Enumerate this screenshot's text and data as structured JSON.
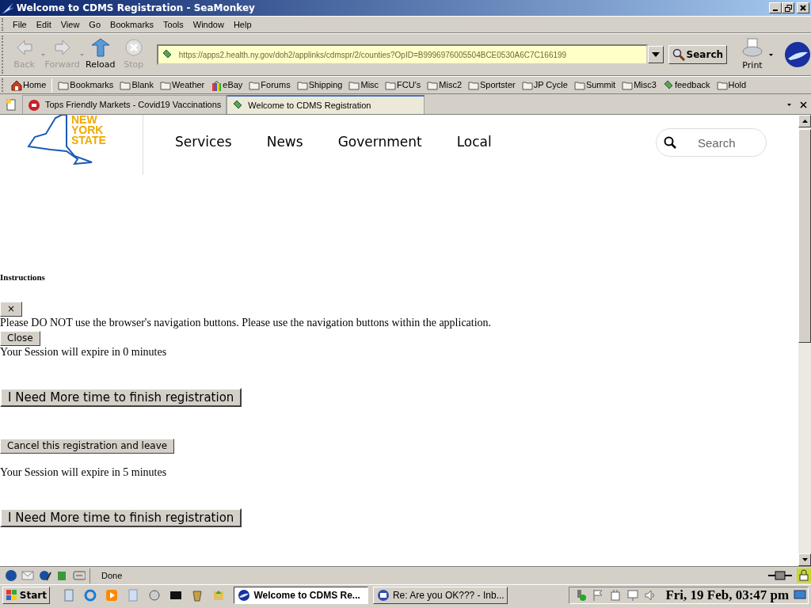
{
  "window": {
    "title": "Welcome to CDMS Registration - SeaMonkey"
  },
  "menu": [
    "File",
    "Edit",
    "View",
    "Go",
    "Bookmarks",
    "Tools",
    "Window",
    "Help"
  ],
  "nav_buttons": [
    {
      "kind": "back",
      "label": "Back",
      "disabled": true
    },
    {
      "kind": "forward",
      "label": "Forward",
      "disabled": true
    },
    {
      "kind": "reload",
      "label": "Reload",
      "disabled": false
    },
    {
      "kind": "stop",
      "label": "Stop",
      "disabled": true
    }
  ],
  "address": {
    "value": "https://apps2.health.ny.gov/doh2/applinks/cdmspr/2/counties?OpID=B9996976005504BCE0530A6C7C166199"
  },
  "search_button": "Search",
  "print_button": "Print",
  "bookmarks": [
    {
      "kind": "home",
      "label": "Home"
    },
    {
      "kind": "folder",
      "label": "Bookmarks"
    },
    {
      "kind": "folder",
      "label": "Blank"
    },
    {
      "kind": "folder",
      "label": "Weather"
    },
    {
      "kind": "bag",
      "label": "eBay"
    },
    {
      "kind": "folder",
      "label": "Forums"
    },
    {
      "kind": "folder",
      "label": "Shipping"
    },
    {
      "kind": "folder",
      "label": "Misc"
    },
    {
      "kind": "folder",
      "label": "FCU's"
    },
    {
      "kind": "folder",
      "label": "Misc2"
    },
    {
      "kind": "folder",
      "label": "Sportster"
    },
    {
      "kind": "folder",
      "label": "JP Cycle"
    },
    {
      "kind": "folder",
      "label": "Summit"
    },
    {
      "kind": "folder",
      "label": "Misc3"
    },
    {
      "kind": "link",
      "label": "feedback"
    },
    {
      "kind": "folder",
      "label": "Hold"
    }
  ],
  "tabs": [
    {
      "label": "Tops Friendly Markets - Covid19 Vaccinations",
      "selected": false
    },
    {
      "label": "Welcome to CDMS Registration",
      "selected": true
    }
  ],
  "site": {
    "logo_lines": [
      "NEW",
      "YORK",
      "STATE"
    ],
    "nav": [
      "Services",
      "News",
      "Government",
      "Local"
    ],
    "search_placeholder": "Search"
  },
  "content": [
    {
      "kind": "heading",
      "text": "Instructions"
    },
    {
      "kind": "small_button",
      "text": "×"
    },
    {
      "kind": "text",
      "text": "Please DO NOT use the browser's navigation buttons. Please use the navigation buttons within the application."
    },
    {
      "kind": "small_button",
      "text": "Close"
    },
    {
      "kind": "text",
      "text": "Your Session will expire in 0 minutes"
    },
    {
      "kind": "large_button",
      "text": "I Need More time to finish registration"
    },
    {
      "kind": "button",
      "text": "Cancel this registration and leave"
    },
    {
      "kind": "text",
      "text": "Your Session will expire in 5 minutes"
    },
    {
      "kind": "large_button",
      "text": "I Need More time to finish registration"
    }
  ],
  "status_bar": {
    "text": "Done"
  },
  "taskbar": {
    "start": "Start",
    "windows": [
      {
        "label": "Welcome to CDMS Re...",
        "selected": true
      },
      {
        "label": "Re: Are you OK??? - Inb...",
        "selected": false
      }
    ],
    "clock": "Fri, 19 Feb, 03:47 pm"
  }
}
